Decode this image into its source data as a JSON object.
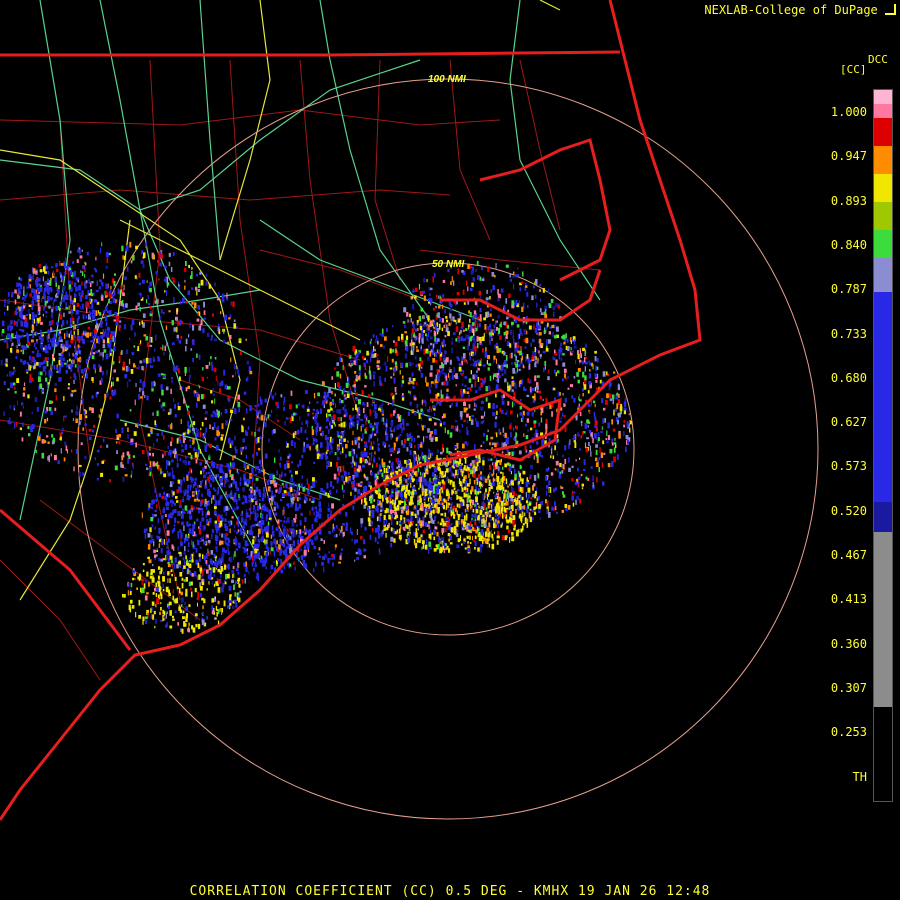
{
  "credit": "NEXLAB-College of DuPage",
  "credit_icon": "resize-corner-icon",
  "footer": "CORRELATION COEFFICIENT (CC) 0.5 DEG - KMHX 19 JAN 26 12:48",
  "range_rings": [
    "100 NMI",
    "50 NMI"
  ],
  "legend": {
    "units_top": "DCC",
    "units_left": "[CC]",
    "ticks": [
      "1.000",
      "0.947",
      "0.893",
      "0.840",
      "0.787",
      "0.733",
      "0.680",
      "0.627",
      "0.573",
      "0.520",
      "0.467",
      "0.413",
      "0.360",
      "0.307",
      "0.253",
      "TH"
    ],
    "colors": {
      "black": "#000000",
      "gray": "#8c8c8c",
      "blue_dark": "#1a1aa0",
      "blue": "#2828e6",
      "blue_light": "#8c8cd2",
      "green": "#3cdc3c",
      "yellow_green": "#a0c800",
      "yellow": "#f0e600",
      "orange": "#ff8c00",
      "red": "#dc0000",
      "pink": "#ff78a0",
      "pink_light": "#ffb4d2"
    }
  },
  "map_colors": {
    "state_border": "#e61e1e",
    "county": "#a01818",
    "highway_green": "#5ad28c",
    "highway_yellow": "#e6e63c",
    "ring": "#e6a08c"
  }
}
